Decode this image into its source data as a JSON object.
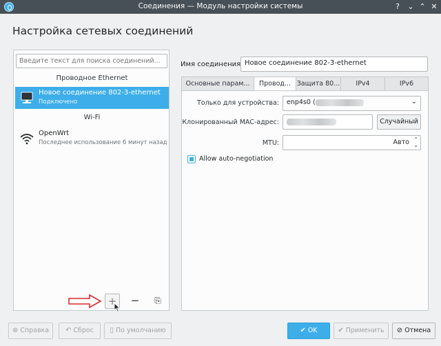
{
  "window": {
    "title": "Соединения — Модуль настройки системы",
    "controls": {
      "help": "?",
      "minimize": "⌄",
      "maximize": "⌃",
      "close": "✕"
    }
  },
  "header": {
    "title": "Настройка сетевых соединений"
  },
  "sidebar": {
    "search_placeholder": "Введите текст для поиска соединений...",
    "sections": [
      {
        "label": "Проводное Ethernet",
        "items": [
          {
            "name": "Новое соединение 802-3-ethernet",
            "status": "Подключено",
            "icon": "wired-network-icon",
            "selected": true
          }
        ]
      },
      {
        "label": "Wi-Fi",
        "items": [
          {
            "name": "OpenWrt",
            "status": "Последнее использование 6 минут назад",
            "icon": "wifi-icon",
            "selected": false
          }
        ]
      }
    ],
    "tools": {
      "add": "+",
      "remove": "−",
      "export": "⎘"
    }
  },
  "editor": {
    "connection_name_label": "Имя соединения:",
    "connection_name_value": "Новое соединение 802-3-ethernet",
    "tabs": [
      {
        "label": "Основные парам...",
        "active": false
      },
      {
        "label": "Провод...",
        "active": true
      },
      {
        "label": "Защита 80...",
        "active": false
      },
      {
        "label": "IPv4",
        "active": false
      },
      {
        "label": "IPv6",
        "active": false
      }
    ],
    "wired": {
      "device_label": "Только для устройства:",
      "device_value": "enp4s0 (",
      "mac_label": "Клонированный MAC-адрес:",
      "random_button": "Случайный",
      "mtu_label": "MTU:",
      "mtu_value": "Авто",
      "autoneg_label": "Allow auto-negotiation",
      "autoneg_checked": true
    }
  },
  "footer": {
    "help": "Справка",
    "reset": "Сброс",
    "defaults": "По умолчанию",
    "ok": "OK",
    "apply": "Применить",
    "cancel": "Отмена"
  },
  "colors": {
    "accent": "#3daee9",
    "titlebar": "#475057",
    "annotation_arrow": "#d92b2b"
  }
}
